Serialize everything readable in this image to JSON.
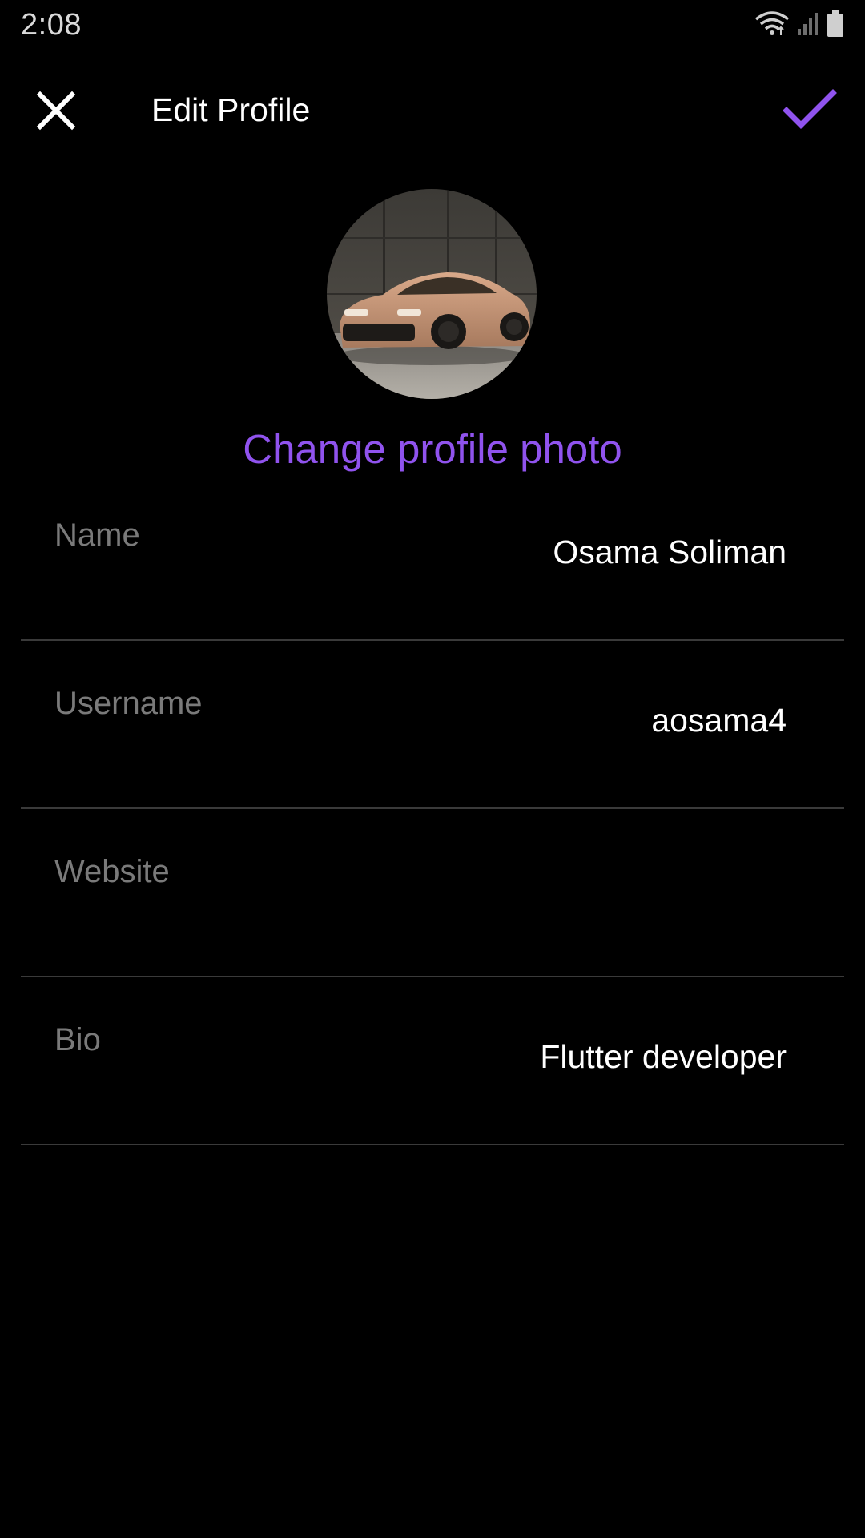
{
  "status_bar": {
    "time": "2:08",
    "icons": [
      "wifi-icon",
      "signal-icon",
      "battery-icon"
    ]
  },
  "app_bar": {
    "title": "Edit Profile",
    "close_icon": "close-icon",
    "save_icon": "check-icon"
  },
  "profile": {
    "avatar_alt": "profile photo",
    "change_photo_label": "Change profile photo"
  },
  "fields": [
    {
      "label": "Name",
      "value": "Osama Soliman"
    },
    {
      "label": "Username",
      "value": "aosama4"
    },
    {
      "label": "Website",
      "value": ""
    },
    {
      "label": "Bio",
      "value": "Flutter developer"
    }
  ],
  "colors": {
    "background": "#000000",
    "accent": "#9053ee",
    "label": "#7a7a7a",
    "divider": "#3a3a3a",
    "text": "#ffffff"
  }
}
